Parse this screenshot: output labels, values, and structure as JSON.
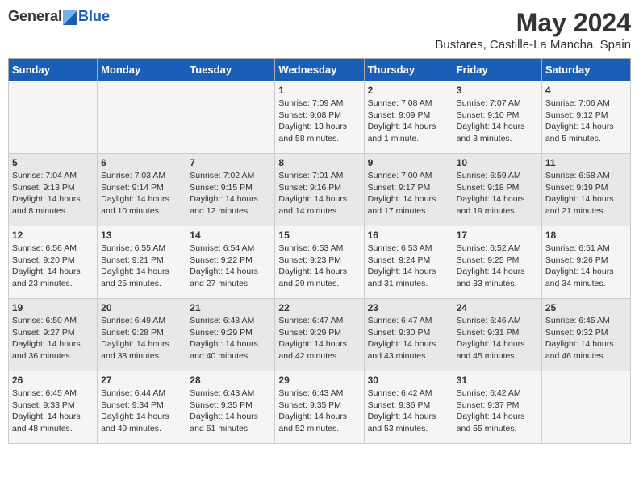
{
  "header": {
    "logo_general": "General",
    "logo_blue": "Blue",
    "title": "May 2024",
    "subtitle": "Bustares, Castille-La Mancha, Spain"
  },
  "days_of_week": [
    "Sunday",
    "Monday",
    "Tuesday",
    "Wednesday",
    "Thursday",
    "Friday",
    "Saturday"
  ],
  "weeks": [
    [
      {
        "day": "",
        "info": ""
      },
      {
        "day": "",
        "info": ""
      },
      {
        "day": "",
        "info": ""
      },
      {
        "day": "1",
        "info": "Sunrise: 7:09 AM\nSunset: 9:08 PM\nDaylight: 13 hours\nand 58 minutes."
      },
      {
        "day": "2",
        "info": "Sunrise: 7:08 AM\nSunset: 9:09 PM\nDaylight: 14 hours\nand 1 minute."
      },
      {
        "day": "3",
        "info": "Sunrise: 7:07 AM\nSunset: 9:10 PM\nDaylight: 14 hours\nand 3 minutes."
      },
      {
        "day": "4",
        "info": "Sunrise: 7:06 AM\nSunset: 9:12 PM\nDaylight: 14 hours\nand 5 minutes."
      }
    ],
    [
      {
        "day": "5",
        "info": "Sunrise: 7:04 AM\nSunset: 9:13 PM\nDaylight: 14 hours\nand 8 minutes."
      },
      {
        "day": "6",
        "info": "Sunrise: 7:03 AM\nSunset: 9:14 PM\nDaylight: 14 hours\nand 10 minutes."
      },
      {
        "day": "7",
        "info": "Sunrise: 7:02 AM\nSunset: 9:15 PM\nDaylight: 14 hours\nand 12 minutes."
      },
      {
        "day": "8",
        "info": "Sunrise: 7:01 AM\nSunset: 9:16 PM\nDaylight: 14 hours\nand 14 minutes."
      },
      {
        "day": "9",
        "info": "Sunrise: 7:00 AM\nSunset: 9:17 PM\nDaylight: 14 hours\nand 17 minutes."
      },
      {
        "day": "10",
        "info": "Sunrise: 6:59 AM\nSunset: 9:18 PM\nDaylight: 14 hours\nand 19 minutes."
      },
      {
        "day": "11",
        "info": "Sunrise: 6:58 AM\nSunset: 9:19 PM\nDaylight: 14 hours\nand 21 minutes."
      }
    ],
    [
      {
        "day": "12",
        "info": "Sunrise: 6:56 AM\nSunset: 9:20 PM\nDaylight: 14 hours\nand 23 minutes."
      },
      {
        "day": "13",
        "info": "Sunrise: 6:55 AM\nSunset: 9:21 PM\nDaylight: 14 hours\nand 25 minutes."
      },
      {
        "day": "14",
        "info": "Sunrise: 6:54 AM\nSunset: 9:22 PM\nDaylight: 14 hours\nand 27 minutes."
      },
      {
        "day": "15",
        "info": "Sunrise: 6:53 AM\nSunset: 9:23 PM\nDaylight: 14 hours\nand 29 minutes."
      },
      {
        "day": "16",
        "info": "Sunrise: 6:53 AM\nSunset: 9:24 PM\nDaylight: 14 hours\nand 31 minutes."
      },
      {
        "day": "17",
        "info": "Sunrise: 6:52 AM\nSunset: 9:25 PM\nDaylight: 14 hours\nand 33 minutes."
      },
      {
        "day": "18",
        "info": "Sunrise: 6:51 AM\nSunset: 9:26 PM\nDaylight: 14 hours\nand 34 minutes."
      }
    ],
    [
      {
        "day": "19",
        "info": "Sunrise: 6:50 AM\nSunset: 9:27 PM\nDaylight: 14 hours\nand 36 minutes."
      },
      {
        "day": "20",
        "info": "Sunrise: 6:49 AM\nSunset: 9:28 PM\nDaylight: 14 hours\nand 38 minutes."
      },
      {
        "day": "21",
        "info": "Sunrise: 6:48 AM\nSunset: 9:29 PM\nDaylight: 14 hours\nand 40 minutes."
      },
      {
        "day": "22",
        "info": "Sunrise: 6:47 AM\nSunset: 9:29 PM\nDaylight: 14 hours\nand 42 minutes."
      },
      {
        "day": "23",
        "info": "Sunrise: 6:47 AM\nSunset: 9:30 PM\nDaylight: 14 hours\nand 43 minutes."
      },
      {
        "day": "24",
        "info": "Sunrise: 6:46 AM\nSunset: 9:31 PM\nDaylight: 14 hours\nand 45 minutes."
      },
      {
        "day": "25",
        "info": "Sunrise: 6:45 AM\nSunset: 9:32 PM\nDaylight: 14 hours\nand 46 minutes."
      }
    ],
    [
      {
        "day": "26",
        "info": "Sunrise: 6:45 AM\nSunset: 9:33 PM\nDaylight: 14 hours\nand 48 minutes."
      },
      {
        "day": "27",
        "info": "Sunrise: 6:44 AM\nSunset: 9:34 PM\nDaylight: 14 hours\nand 49 minutes."
      },
      {
        "day": "28",
        "info": "Sunrise: 6:43 AM\nSunset: 9:35 PM\nDaylight: 14 hours\nand 51 minutes."
      },
      {
        "day": "29",
        "info": "Sunrise: 6:43 AM\nSunset: 9:35 PM\nDaylight: 14 hours\nand 52 minutes."
      },
      {
        "day": "30",
        "info": "Sunrise: 6:42 AM\nSunset: 9:36 PM\nDaylight: 14 hours\nand 53 minutes."
      },
      {
        "day": "31",
        "info": "Sunrise: 6:42 AM\nSunset: 9:37 PM\nDaylight: 14 hours\nand 55 minutes."
      },
      {
        "day": "",
        "info": ""
      }
    ]
  ]
}
